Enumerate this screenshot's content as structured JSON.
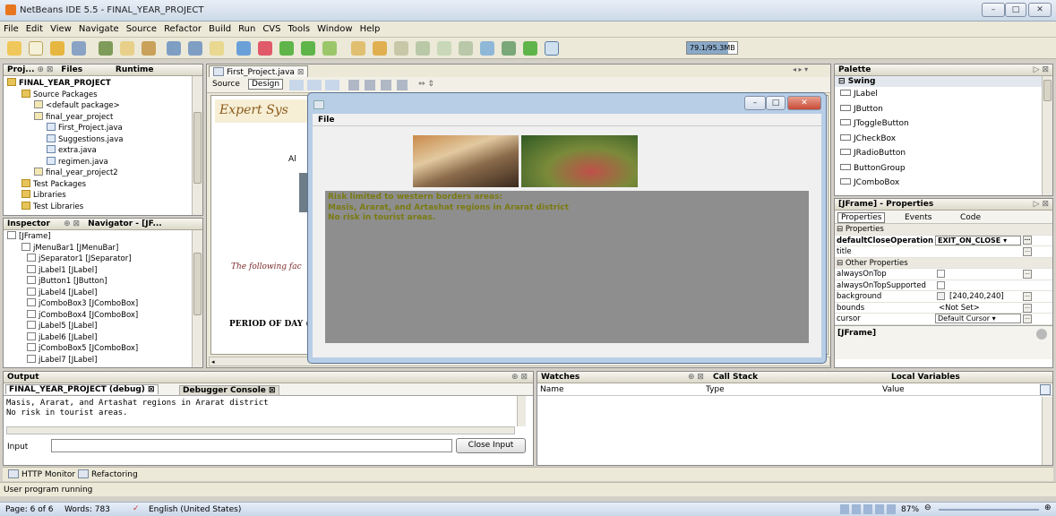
{
  "window": {
    "title": "NetBeans IDE 5.5 - FINAL_YEAR_PROJECT",
    "controls": [
      "–",
      "□",
      "✕"
    ]
  },
  "menubar": [
    "File",
    "Edit",
    "View",
    "Navigate",
    "Source",
    "Refactor",
    "Build",
    "Run",
    "CVS",
    "Tools",
    "Window",
    "Help"
  ],
  "toolbar": {
    "memory": "79.1/95.3MB",
    "memory_fraction": 0.83
  },
  "projects": {
    "tabs": [
      "Proj...",
      "Files",
      "Runtime"
    ],
    "tree": [
      "FINAL_YEAR_PROJECT",
      "Source Packages",
      "<default package>",
      "final_year_project",
      "First_Project.java",
      "Suggestions.java",
      "extra.java",
      "regimen.java",
      "final_year_project2",
      "Test Packages",
      "Libraries",
      "Test Libraries"
    ]
  },
  "inspector": {
    "tabs": [
      "Inspector",
      "Navigator - [JF..."
    ],
    "tree": [
      "[JFrame]",
      "jMenuBar1 [JMenuBar]",
      "jSeparator1 [JSeparator]",
      "jLabel1 [JLabel]",
      "jButton1 [JButton]",
      "jLabel4 [JLabel]",
      "jComboBox3 [JComboBox]",
      "jComboBox4 [JComboBox]",
      "jLabel5 [JLabel]",
      "jLabel6 [JLabel]",
      "jComboBox5 [JComboBox]",
      "jLabel7 [JLabel]"
    ]
  },
  "editor": {
    "tab": "First_Project.java",
    "modes": [
      "Source",
      "Design"
    ],
    "heading": "Expert Sys",
    "side_text": "Al",
    "following": "The following fac",
    "period": "PERIOD OF DAY (*"
  },
  "dialog": {
    "menu": "File",
    "lines": [
      "Risk limited to western borders areas:",
      "Masis, Ararat, and Artashat regions in Ararat district",
      "No risk in tourist areas."
    ]
  },
  "palette": {
    "title": "Palette",
    "group": "Swing",
    "items": [
      "JLabel",
      "JButton",
      "JToggleButton",
      "JCheckBox",
      "JRadioButton",
      "ButtonGroup",
      "JComboBox"
    ]
  },
  "properties": {
    "title": "[JFrame] - Properties",
    "tabs": [
      "Properties",
      "Events",
      "Code"
    ],
    "section1": "Properties",
    "rows1": [
      {
        "name": "defaultCloseOperation",
        "value": "EXIT_ON_CLOSE"
      },
      {
        "name": "title",
        "value": ""
      }
    ],
    "section2": "Other Properties",
    "rows2": [
      {
        "name": "alwaysOnTop",
        "value": ""
      },
      {
        "name": "alwaysOnTopSupported",
        "value": ""
      },
      {
        "name": "background",
        "value": "[240,240,240]"
      },
      {
        "name": "bounds",
        "value": "<Not Set>"
      },
      {
        "name": "cursor",
        "value": "Default Cursor"
      }
    ],
    "footer": "[JFrame]"
  },
  "output": {
    "title": "Output",
    "tabs": [
      "FINAL_YEAR_PROJECT (debug)",
      "Debugger Console"
    ],
    "lines": [
      "Masis, Ararat, and Artashat regions in Ararat district",
      "No risk in tourist areas."
    ],
    "input_label": "Input",
    "close_button": "Close Input"
  },
  "watches": {
    "title": "Watches",
    "callstack": "Call Stack",
    "locals": "Local Variables",
    "columns": [
      "Name",
      "Type",
      "Value"
    ]
  },
  "bottom_tabs": [
    "HTTP Monitor",
    "Refactoring"
  ],
  "status": "User program running",
  "taskbar": {
    "page": "Page: 6 of 6",
    "words": "Words: 783",
    "lang": "English (United States)",
    "zoom": "87%"
  }
}
